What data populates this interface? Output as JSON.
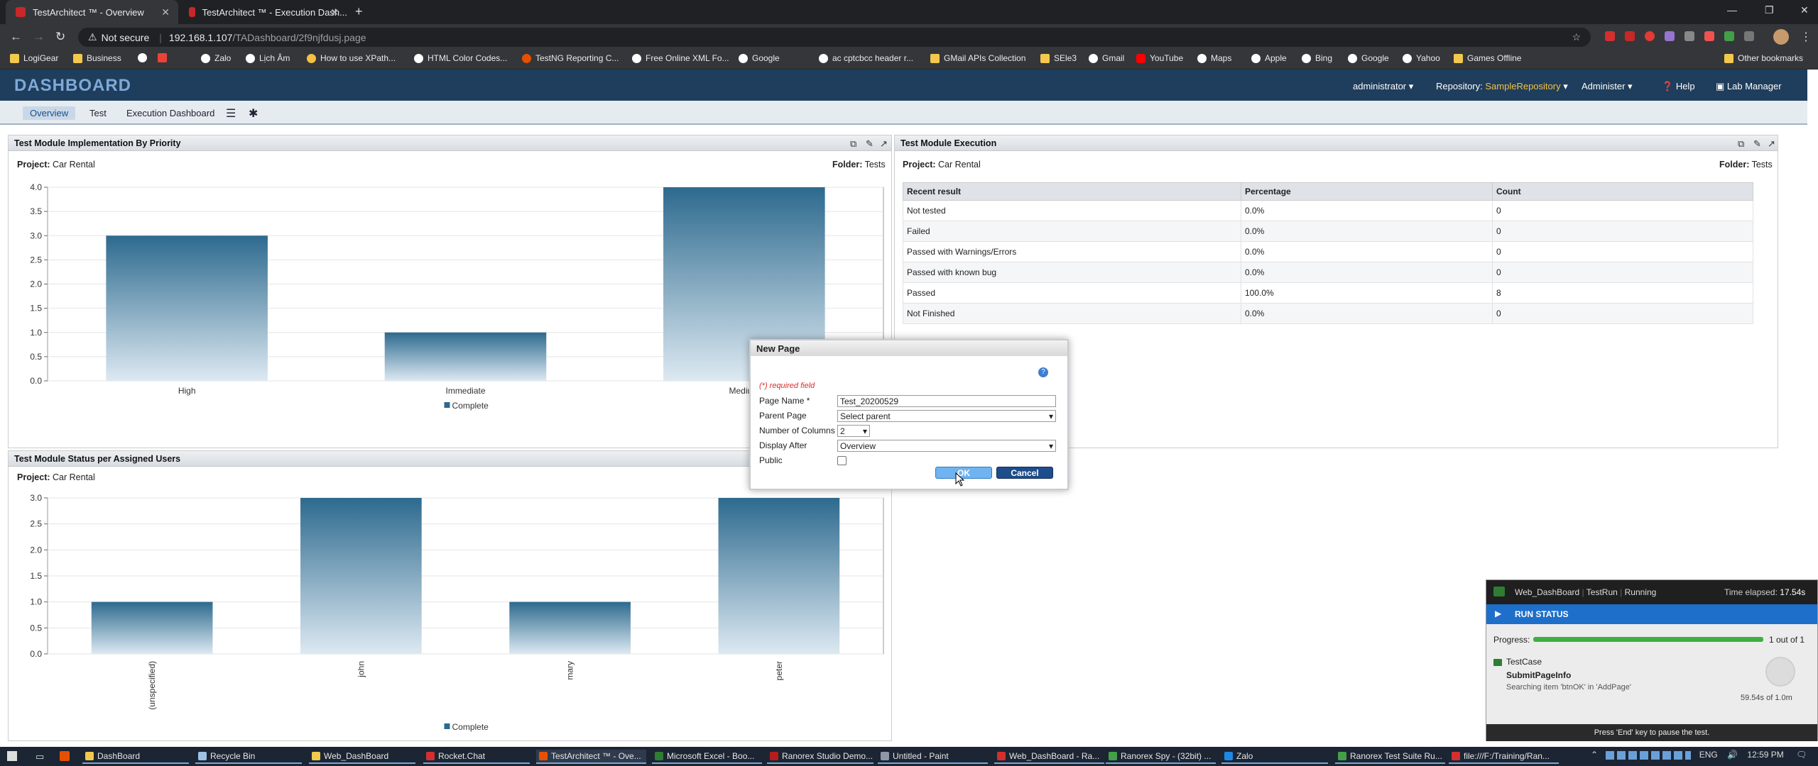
{
  "browser": {
    "tabs": [
      {
        "title": "TestArchitect ™ - Overview",
        "active": true
      },
      {
        "title": "TestArchitect ™ - Execution Dash...",
        "active": false
      }
    ],
    "new_tab": "+",
    "security": "Not secure",
    "url_host": "192.168.1.107",
    "url_path": "/TADashboard/2f9njfdusj.page",
    "bookmarks": [
      "LogiGear",
      "Business",
      "",
      "",
      "Zalo",
      "Lịch Âm",
      "How to use XPath...",
      "HTML Color Codes...",
      "TestNG Reporting C...",
      "Free Online XML Fo...",
      "Google",
      "ac cptcbcc header r...",
      "GMail APIs Collection",
      "SEle3",
      "Gmail",
      "YouTube",
      "Maps",
      "Apple",
      "Bing",
      "Google",
      "Yahoo",
      "Games Offline"
    ],
    "other_bookmarks": "Other bookmarks"
  },
  "header": {
    "logo": "DASHBOARD",
    "user": "administrator",
    "repository_label": "Repository:",
    "repository_value": "SampleRepository",
    "administer": "Administer",
    "help": "Help",
    "lab_manager": "Lab Manager"
  },
  "subnav": {
    "tabs": [
      "Overview",
      "Test",
      "Execution Dashboard"
    ]
  },
  "panels": {
    "p1": {
      "title": "Test Module Implementation By Priority",
      "project_label": "Project:",
      "project": "Car Rental",
      "folder_label": "Folder:",
      "folder": "Tests",
      "legend": "Complete"
    },
    "p2": {
      "title": "Test Module Execution",
      "project_label": "Project:",
      "project": "Car Rental",
      "folder_label": "Folder:",
      "folder": "Tests",
      "columns": [
        "Recent result",
        "Percentage",
        "Count"
      ],
      "rows": [
        [
          "Not tested",
          "0.0%",
          "0"
        ],
        [
          "Failed",
          "0.0%",
          "0"
        ],
        [
          "Passed with Warnings/Errors",
          "0.0%",
          "0"
        ],
        [
          "Passed with known bug",
          "0.0%",
          "0"
        ],
        [
          "Passed",
          "100.0%",
          "8"
        ],
        [
          "Not Finished",
          "0.0%",
          "0"
        ]
      ]
    },
    "p3": {
      "title": "Test Module Status per Assigned Users",
      "project_label": "Project:",
      "project": "Car Rental",
      "legend": "Complete"
    }
  },
  "chart_data": [
    {
      "type": "bar",
      "title": "Test Module Implementation By Priority",
      "categories": [
        "High",
        "Immediate",
        "Medium"
      ],
      "series": [
        {
          "name": "Complete",
          "values": [
            3.0,
            1.0,
            4.0
          ]
        }
      ],
      "ylim": [
        0,
        4.0
      ],
      "yticks": [
        "0.0",
        "0.5",
        "1.0",
        "1.5",
        "2.0",
        "2.5",
        "3.0",
        "3.5",
        "4.0"
      ],
      "xlabel": "",
      "ylabel": "",
      "grid": true,
      "legend": "bottom",
      "color": "#2d6a8e"
    },
    {
      "type": "bar",
      "title": "Test Module Status per Assigned Users",
      "categories": [
        "(unspecified)",
        "john",
        "mary",
        "peter"
      ],
      "series": [
        {
          "name": "Complete",
          "values": [
            1.0,
            3.0,
            1.0,
            3.0
          ]
        }
      ],
      "ylim": [
        0,
        3.0
      ],
      "yticks": [
        "0.0",
        "0.5",
        "1.0",
        "1.5",
        "2.0",
        "2.5",
        "3.0"
      ],
      "xlabel": "",
      "ylabel": "",
      "grid": true,
      "legend": "bottom",
      "color": "#2d6a8e"
    }
  ],
  "dialog": {
    "title": "New Page",
    "required_note": "(*) required field",
    "page_name_label": "Page Name *",
    "page_name_value": "Test_20200529",
    "parent_label": "Parent Page",
    "parent_value": "Select parent",
    "columns_label": "Number of Columns",
    "columns_value": "2",
    "display_after_label": "Display After",
    "display_after_value": "Overview",
    "public_label": "Public",
    "ok": "OK",
    "cancel": "Cancel"
  },
  "runstatus": {
    "app": "Web_DashBoard",
    "run": "TestRun",
    "state": "Running",
    "elapsed_label": "Time elapsed:",
    "elapsed": "17.54s",
    "section": "RUN STATUS",
    "progress_label": "Progress:",
    "progress_text": "1 out of 1",
    "progress": 1.0,
    "testcase_label": "TestCase",
    "testcase": "SubmitPageInfo",
    "message": "Searching item 'btnOK' in 'AddPage'",
    "timer": "59.54s of 1.0m",
    "footer": "Press 'End' key to pause the test."
  },
  "taskbar": {
    "items": [
      "DashBoard",
      "Recycle Bin",
      "Web_DashBoard",
      "Rocket.Chat",
      "TestArchitect ™ - Ove...",
      "Microsoft Excel - Boo...",
      "Ranorex Studio Demo...",
      "Untitled - Paint",
      "Web_DashBoard - Ra...",
      "Ranorex Spy - (32bit) ...",
      "Zalo",
      "Ranorex Test Suite Ru...",
      "file:///F:/Training/Ran..."
    ],
    "lang": "ENG",
    "time": "12:59 PM"
  }
}
